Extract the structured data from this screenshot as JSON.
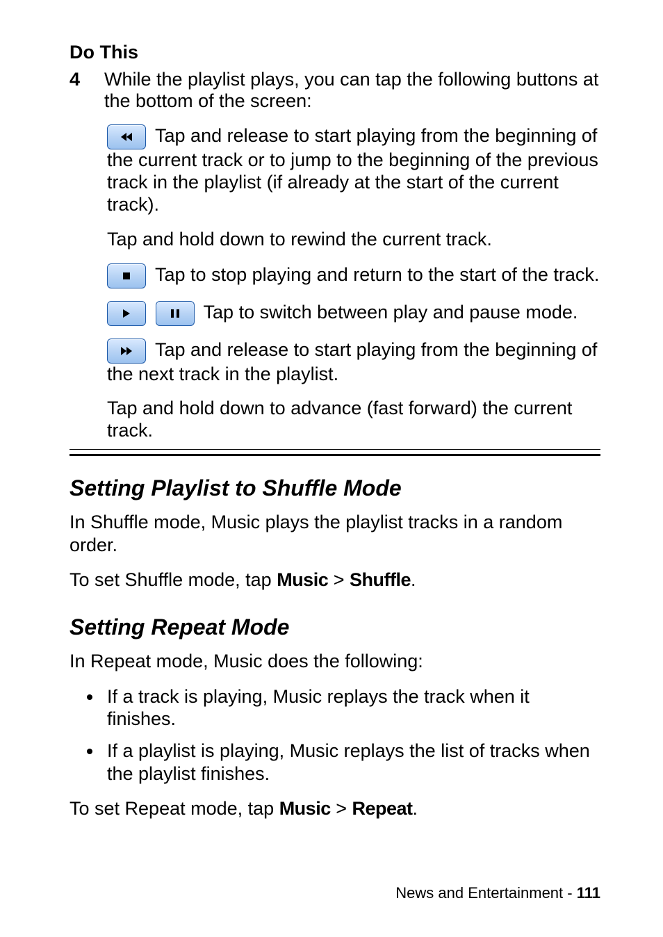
{
  "header": {
    "do_this": "Do This"
  },
  "step": {
    "number": "4",
    "intro": "While the playlist plays, you can tap the following buttons at the bottom of the screen:"
  },
  "buttons": {
    "rewind": {
      "para1_before": "",
      "para1_after": " Tap and release to start playing from the beginning of the current track or to jump to the beginning of the previous track in the playlist (if already at the start of the current track).",
      "para2": "Tap and hold down to rewind the current track."
    },
    "stop": {
      "para_after": " Tap to stop playing and return to the start of the track."
    },
    "playpause": {
      "para_after": " Tap to switch between play and pause mode."
    },
    "forward": {
      "para1_after": " Tap and release to start playing from the beginning of the next track in the playlist.",
      "para2": "Tap and hold down to advance (fast forward) the current track."
    }
  },
  "shuffle": {
    "heading": "Setting Playlist to Shuffle Mode",
    "body": "In Shuffle mode, Music plays the playlist tracks in a random order.",
    "instr_prefix": "To set Shuffle mode, tap ",
    "music": "Music",
    "sep": " > ",
    "shuffle_label": "Shuffle",
    "period": "."
  },
  "repeat": {
    "heading": "Setting Repeat Mode",
    "body": "In Repeat mode, Music does the following:",
    "bullet1": "If a track is playing, Music replays the track when it finishes.",
    "bullet2": "If a playlist is playing, Music replays the list of tracks when the playlist finishes.",
    "instr_prefix": "To set Repeat mode, tap ",
    "music": "Music",
    "sep": " > ",
    "repeat_label": "Repeat",
    "period": "."
  },
  "footer": {
    "section": "News and Entertainment - ",
    "page": "111"
  }
}
